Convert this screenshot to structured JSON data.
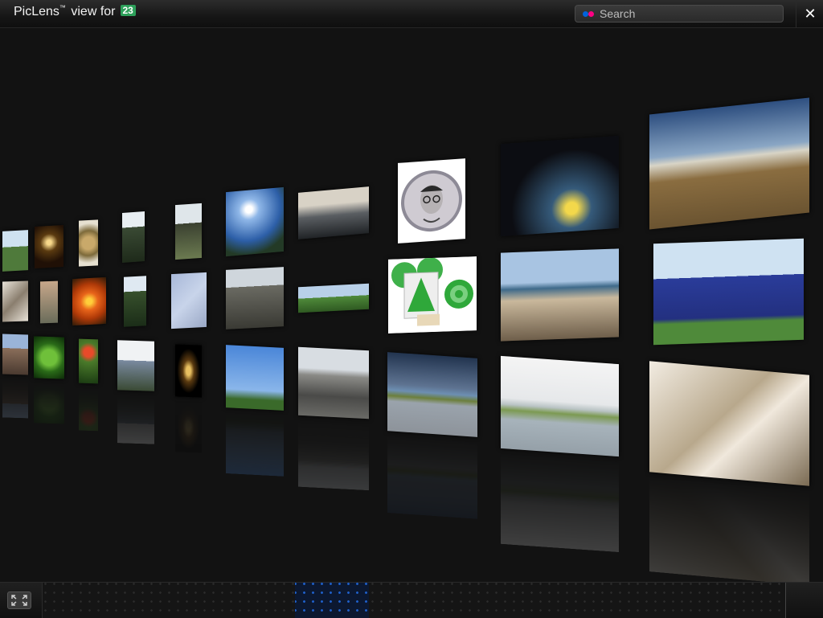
{
  "header": {
    "title_main": "PicLens",
    "title_tm": "™",
    "title_suffix": " view for",
    "brand_badge": "23"
  },
  "search": {
    "placeholder": "Search",
    "icon": "flickr-dots-icon"
  },
  "close": {
    "label": "✕",
    "icon": "close-icon"
  },
  "bottom": {
    "fullscreen_icon": "fullscreen-icon",
    "scroll_position_fraction": 0.34,
    "scroll_visible_fraction": 0.1
  },
  "wall": {
    "photos": [
      {
        "id": "red-house",
        "desc": "small red house on grass"
      },
      {
        "id": "sparkles",
        "desc": "sparkler lights"
      },
      {
        "id": "festive-tree",
        "desc": "decorated tree"
      },
      {
        "id": "church-tree",
        "desc": "church tower and trees"
      },
      {
        "id": "monument",
        "desc": "monument with trees"
      },
      {
        "id": "sun-river",
        "desc": "sun over river"
      },
      {
        "id": "dark-tree",
        "desc": "dark tree silhouette"
      },
      {
        "id": "portrait-badge",
        "desc": "portrait badge of a man with glasses"
      },
      {
        "id": "night-lights",
        "desc": "night scene with lights"
      },
      {
        "id": "field-sky",
        "desc": "field under sky"
      },
      {
        "id": "rigging",
        "desc": "ship rigging"
      },
      {
        "id": "plant",
        "desc": "plant close-up"
      },
      {
        "id": "orange-flower",
        "desc": "orange flower"
      },
      {
        "id": "spire",
        "desc": "spire with trees"
      },
      {
        "id": "sky-trails",
        "desc": "sky with trails"
      },
      {
        "id": "building-tower",
        "desc": "building with tower"
      },
      {
        "id": "green-strip",
        "desc": "green field panorama"
      },
      {
        "id": "green-cones",
        "desc": "green cone graphics"
      },
      {
        "id": "beach",
        "desc": "beach with pier"
      },
      {
        "id": "blue-cube",
        "desc": "blue cube building"
      },
      {
        "id": "street",
        "desc": "street with buildings"
      },
      {
        "id": "clover",
        "desc": "four-leaf clover"
      },
      {
        "id": "red-mushroom",
        "desc": "red mushroom"
      },
      {
        "id": "castle",
        "desc": "castle towers"
      },
      {
        "id": "lantern",
        "desc": "lantern on black"
      },
      {
        "id": "flagpole",
        "desc": "flagpole with pennant"
      },
      {
        "id": "church-plaza",
        "desc": "church and plaza"
      },
      {
        "id": "lighthouse-cloudy",
        "desc": "lighthouse coast with clouds"
      },
      {
        "id": "lighthouse-water",
        "desc": "lighthouse across water"
      },
      {
        "id": "sailboat",
        "desc": "sailboat rigging sepia"
      }
    ]
  }
}
